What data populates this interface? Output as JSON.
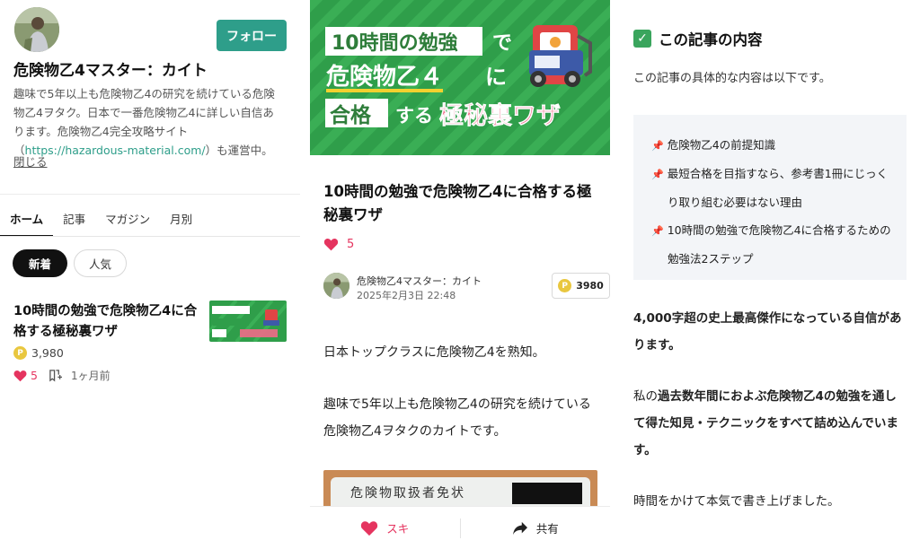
{
  "profile": {
    "name": "危険物乙4マスター：カイト",
    "follow_label": "フォロー",
    "bio_text": "趣味で5年以上も危険物乙4の研究を続けている危険物乙4ヲタク。日本で一番危険物乙4に詳しい自信あります。危険物乙4完全攻略サイト（",
    "bio_link": "https://hazardous-material.com/",
    "bio_suffix": "）も運営中。",
    "close_label": "閉じる"
  },
  "nav": {
    "tabs": [
      {
        "label": "ホーム",
        "active": true
      },
      {
        "label": "記事",
        "active": false
      },
      {
        "label": "マガジン",
        "active": false
      },
      {
        "label": "月別",
        "active": false
      }
    ],
    "chips": [
      "新着",
      "人気"
    ]
  },
  "card": {
    "title": "10時間の勉強で危険物乙4に合格する極秘裏ワザ",
    "price": "3,980",
    "likes": "5",
    "time": "1ヶ月前"
  },
  "hero": {
    "line1": "10時間の勉強",
    "line1_suffix": "で",
    "line2": "危険物乙４",
    "line2_suffix": "に",
    "line3_a": "合格",
    "line3_b": "する",
    "line3_c": "極秘裏ワザ"
  },
  "article": {
    "title": "10時間の勉強で危険物乙4に合格する極秘裏ワザ",
    "likes": "5",
    "author": "危険物乙4マスター：カイト",
    "date": "2025年2月3日 22:48",
    "price": "3980",
    "para1": "日本トップクラスに危険物乙4を熟知。",
    "para2": "趣味で5年以上も危険物乙4の研究を続けている危険物乙4ヲタクのカイトです。",
    "proof_text": "危険物取扱者免状",
    "like_label": "スキ",
    "share_label": "共有"
  },
  "toc": {
    "heading": "この記事の内容",
    "intro": "この記事の具体的な内容は以下です。",
    "items": [
      "危険物乙4の前提知識",
      "最短合格を目指すなら、参考書1冊にじっくり取り組む必要はない理由",
      "10時間の勉強で危険物乙4に合格するための勉強法2ステップ"
    ],
    "confidence": "4,000字超の史上最高傑作になっている自信があります。",
    "para_prefix": "私の",
    "para_bold": "過去数年間におよぶ危険物乙4の勉強を通して得た知見・テクニックをすべて詰め込んでいます。",
    "closing": "時間をかけて本気で書き上げました。"
  },
  "colors": {
    "accent": "#2e9e8a",
    "hero_green": "#2f9e4a",
    "like_pink": "#e5345f",
    "coin_gold": "#e9c73f"
  }
}
